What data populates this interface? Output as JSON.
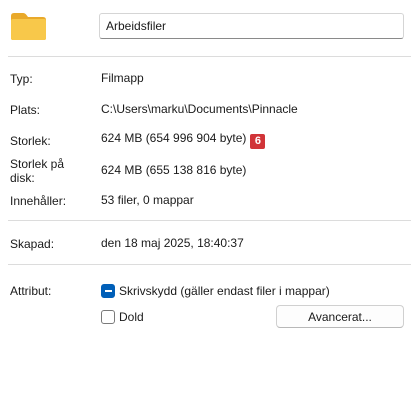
{
  "general": {
    "name_value": "Arbeidsfiler",
    "icon": "folder-icon"
  },
  "details": [
    {
      "label": "Typ:",
      "value": "Filmapp"
    },
    {
      "label": "Plats:",
      "value": "C:\\Users\\marku\\Documents\\Pinnacle"
    },
    {
      "label": "Storlek:",
      "value": "624 MB (654 996 904 byte)"
    },
    {
      "label": "Storlek på disk:",
      "value": "624 MB (655 138 816 byte)"
    },
    {
      "label": "Innehåller:",
      "value": "53 filer, 0 mappar"
    }
  ],
  "size_badge": "6",
  "created": {
    "label": "Skapad:",
    "value": "den 18 maj 2025, 18:40:37"
  },
  "attributes": {
    "label": "Attribut:",
    "readonly_label": "Skrivskydd (gäller endast filer i mappar)",
    "readonly_state": "indeterminate",
    "hidden_label": "Dold",
    "hidden_state": "unchecked",
    "advanced_button": "Avancerat..."
  },
  "colors": {
    "accent": "#005fb8",
    "badge": "#d13438",
    "folder": "#f8c84a"
  }
}
